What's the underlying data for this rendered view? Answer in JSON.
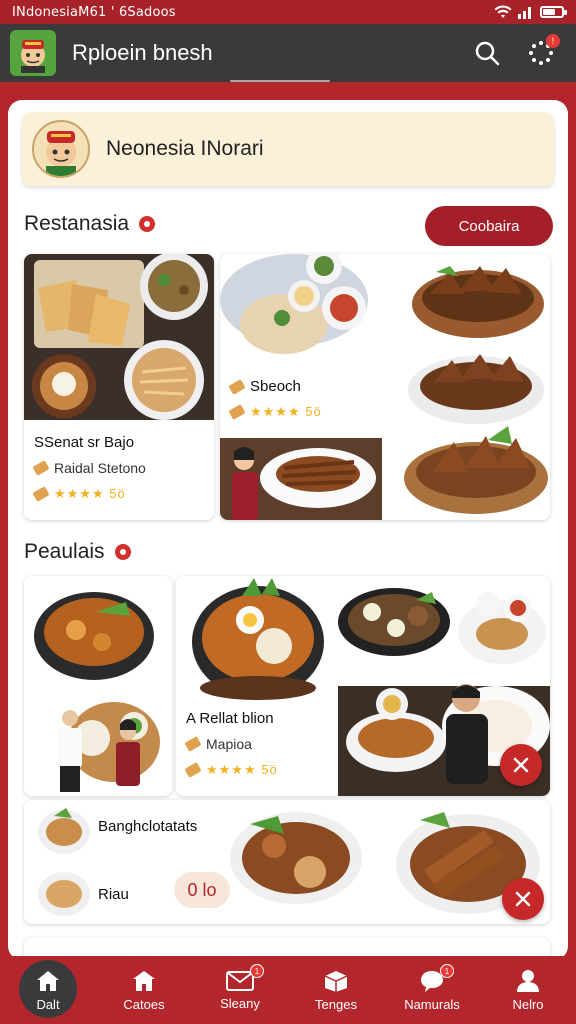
{
  "status_bar": {
    "text": "INdonesiaM61 ' 6Sadoos"
  },
  "app_bar": {
    "title": "Rploein bnesh"
  },
  "user": {
    "name": "Neonesia INorari"
  },
  "section1": {
    "title": "Restanasia",
    "button_label": "Coobaira"
  },
  "restaurant_card_1": {
    "name": "SSenat sr Bajo",
    "subtitle": "Raidal Stetono",
    "rating_text": "★★★★ 5ö"
  },
  "restaurant_card_2": {
    "name": "Sbeoch",
    "rating_text": "★★★★ 5ö"
  },
  "section2": {
    "title": "Peaulais"
  },
  "restaurant_card_3": {
    "name": "A Rellat blion",
    "subtitle": "Mapioa",
    "rating_text": "★★★★ 5ö"
  },
  "list_card": {
    "item1": "Banghclotatats",
    "item2": "Riau",
    "price": "0 lo"
  },
  "bottom_nav": [
    {
      "label": "Dalt",
      "icon": "home-icon"
    },
    {
      "label": "Catoes",
      "icon": "store-icon"
    },
    {
      "label": "Sleany",
      "icon": "mail-icon"
    },
    {
      "label": "Tenges",
      "icon": "box-icon"
    },
    {
      "label": "Namurals",
      "icon": "chat-icon"
    },
    {
      "label": "Nelro",
      "icon": "profile-icon"
    }
  ],
  "colors": {
    "primary": "#b3262b",
    "appbar": "#3a3a3c",
    "card": "#fbf1d8"
  }
}
